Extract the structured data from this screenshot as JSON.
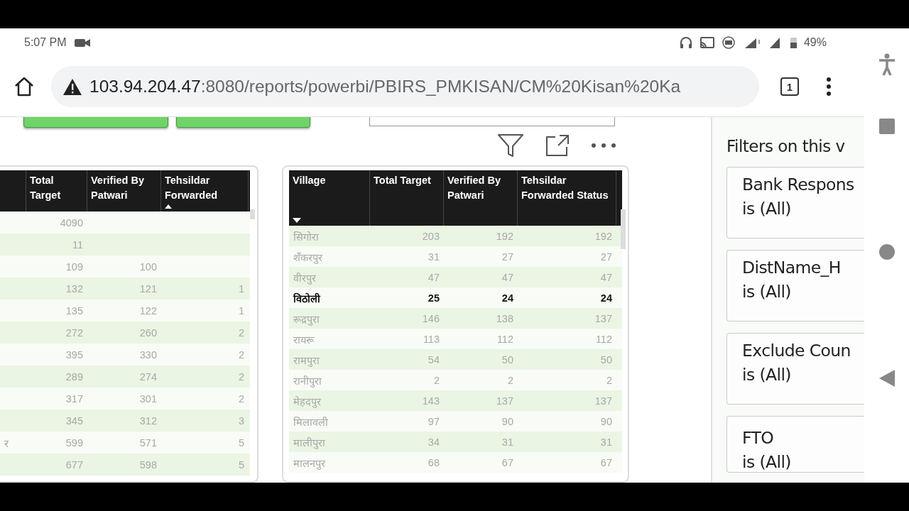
{
  "status_bar": {
    "time": "5:07 PM",
    "battery": "49%"
  },
  "address_bar": {
    "host": "103.94.204.47",
    "path": ":8080/reports/powerbi/PBIRS_PMKISAN/CM%20Kisan%20Ka",
    "tab_count": "1"
  },
  "left_table": {
    "columns": [
      {
        "label": "Total Target",
        "sorted_ascending": false,
        "sorted_descending": false
      },
      {
        "label": "Verified By Patwari",
        "sorted_ascending": false,
        "sorted_descending": false
      },
      {
        "label": "Tehsildar Forwarded",
        "sorted_ascending": true,
        "sorted_descending": false
      }
    ],
    "rows": [
      [
        null,
        "4090",
        null,
        null
      ],
      [
        null,
        "11",
        null,
        null
      ],
      [
        null,
        "109",
        "100",
        null
      ],
      [
        null,
        "132",
        "121",
        "1"
      ],
      [
        null,
        "135",
        "122",
        "1"
      ],
      [
        null,
        "272",
        "260",
        "2"
      ],
      [
        null,
        "395",
        "330",
        "2"
      ],
      [
        null,
        "289",
        "274",
        "2"
      ],
      [
        null,
        "317",
        "301",
        "2"
      ],
      [
        null,
        "345",
        "312",
        "3"
      ],
      [
        "र",
        "599",
        "571",
        "5"
      ],
      [
        null,
        "677",
        "598",
        "5"
      ]
    ]
  },
  "right_table": {
    "columns": [
      {
        "label": "Village",
        "sorted_ascending": false,
        "sorted_descending": true
      },
      {
        "label": "Total Target",
        "sorted_ascending": false,
        "sorted_descending": false
      },
      {
        "label": "Verified By Patwari",
        "sorted_ascending": false,
        "sorted_descending": false
      },
      {
        "label": "Tehsildar Forwarded Status",
        "sorted_ascending": false,
        "sorted_descending": false
      }
    ],
    "rows": [
      {
        "cells": [
          "सिगोरा",
          "203",
          "192",
          "192"
        ],
        "selected": false
      },
      {
        "cells": [
          "शँकरपुर",
          "31",
          "27",
          "27"
        ],
        "selected": false
      },
      {
        "cells": [
          "वीरपुर",
          "47",
          "47",
          "47"
        ],
        "selected": false
      },
      {
        "cells": [
          "विठोली",
          "25",
          "24",
          "24"
        ],
        "selected": true
      },
      {
        "cells": [
          "रूद्रपुरा",
          "146",
          "138",
          "137"
        ],
        "selected": false
      },
      {
        "cells": [
          "रायरू",
          "113",
          "112",
          "112"
        ],
        "selected": false
      },
      {
        "cells": [
          "रामपुरा",
          "54",
          "50",
          "50"
        ],
        "selected": false
      },
      {
        "cells": [
          "रानीपुरा",
          "2",
          "2",
          "2"
        ],
        "selected": false
      },
      {
        "cells": [
          "मेहदपुर",
          "143",
          "137",
          "137"
        ],
        "selected": false
      },
      {
        "cells": [
          "मिलावली",
          "97",
          "90",
          "90"
        ],
        "selected": false
      },
      {
        "cells": [
          "मालीपुरा",
          "34",
          "31",
          "31"
        ],
        "selected": false
      },
      {
        "cells": [
          "मालनपुर",
          "68",
          "67",
          "67"
        ],
        "selected": false
      }
    ]
  },
  "filter_pane": {
    "title": "Filters on this v",
    "filters": [
      {
        "field": "Bank Respons",
        "condition": "is (All)"
      },
      {
        "field": "DistName_H",
        "condition": "is (All)"
      },
      {
        "field": "Exclude Coun",
        "condition": "is (All)"
      },
      {
        "field": "FTO",
        "condition": "is (All)"
      }
    ]
  }
}
